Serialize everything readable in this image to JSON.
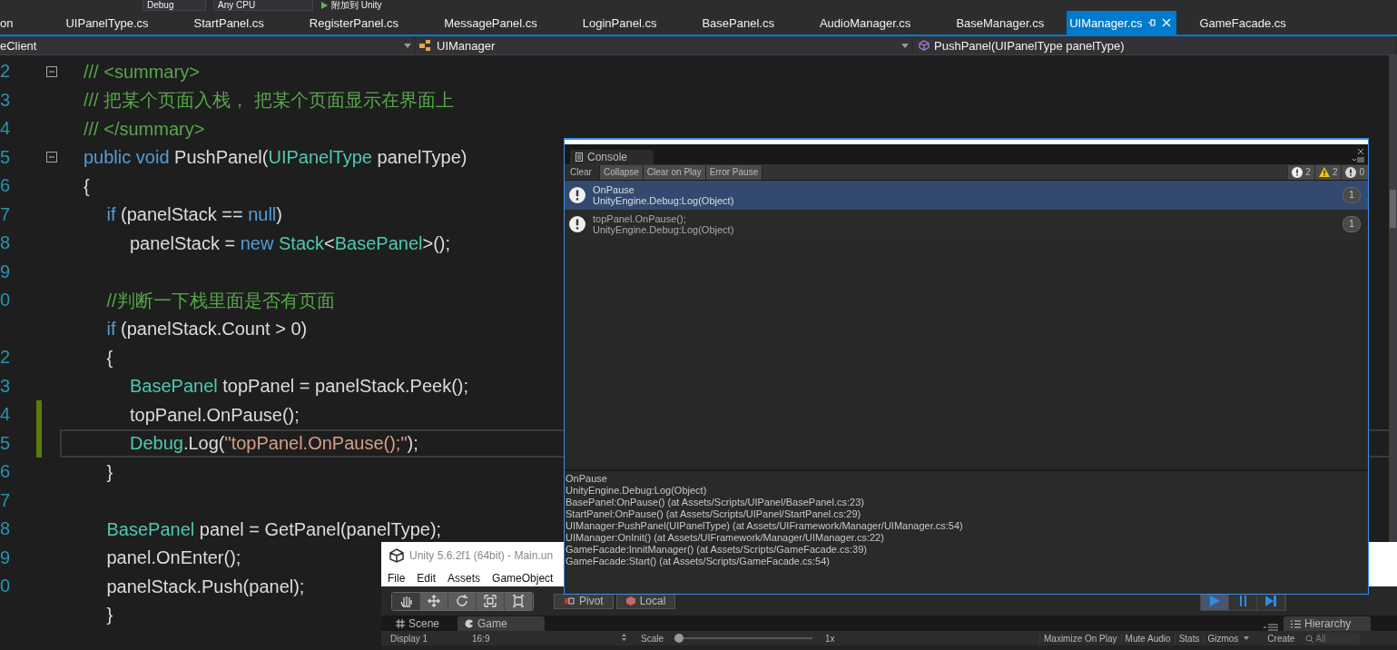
{
  "toolbar": {
    "configuration": "Debug",
    "platform": "Any CPU",
    "run_button": "附加到 Unity"
  },
  "tabs": [
    {
      "label": "on",
      "selected": false
    },
    {
      "label": "UIPanelType.cs",
      "selected": false
    },
    {
      "label": "StartPanel.cs",
      "selected": false
    },
    {
      "label": "RegisterPanel.cs",
      "selected": false
    },
    {
      "label": "MessagePanel.cs",
      "selected": false
    },
    {
      "label": "LoginPanel.cs",
      "selected": false
    },
    {
      "label": "BasePanel.cs",
      "selected": false
    },
    {
      "label": "AudioManager.cs",
      "selected": false
    },
    {
      "label": "BaseManager.cs",
      "selected": false
    },
    {
      "label": "UIManager.cs",
      "selected": true
    },
    {
      "label": "GameFacade.cs",
      "selected": false
    }
  ],
  "nav": {
    "project": "eClient",
    "class": "UIManager",
    "member": "PushPanel(UIPanelType panelType)"
  },
  "code": {
    "lines": [
      {
        "number": "2",
        "fold": true,
        "changed": false,
        "current": false,
        "tokens": [
          {
            "kind": "comment",
            "text": "/// <summary>"
          }
        ]
      },
      {
        "number": "3",
        "fold": false,
        "changed": false,
        "current": false,
        "tokens": [
          {
            "kind": "comment",
            "text": "/// 把某个页面入栈， 把某个页面显示在界面上"
          }
        ]
      },
      {
        "number": "4",
        "fold": false,
        "changed": false,
        "current": false,
        "tokens": [
          {
            "kind": "comment",
            "text": "/// </summary>"
          }
        ]
      },
      {
        "number": "5",
        "fold": true,
        "changed": false,
        "current": false,
        "tokens": [
          {
            "kind": "keyword",
            "text": "public void "
          },
          {
            "kind": "plain",
            "text": "PushPanel("
          },
          {
            "kind": "type",
            "text": "UIPanelType"
          },
          {
            "kind": "plain",
            "text": " panelType)"
          }
        ]
      },
      {
        "number": "6",
        "fold": false,
        "changed": false,
        "current": false,
        "tokens": [
          {
            "kind": "plain",
            "text": "{"
          }
        ]
      },
      {
        "number": "7",
        "fold": false,
        "changed": false,
        "current": false,
        "tokens": [
          {
            "kind": "keyword",
            "text": "\tif"
          },
          {
            "kind": "plain",
            "text": " (panelStack == "
          },
          {
            "kind": "keyword",
            "text": "null"
          },
          {
            "kind": "plain",
            "text": ")"
          }
        ]
      },
      {
        "number": "8",
        "fold": false,
        "changed": false,
        "current": false,
        "tokens": [
          {
            "kind": "plain",
            "text": "\t\tpanelStack = "
          },
          {
            "kind": "keyword",
            "text": "new "
          },
          {
            "kind": "type",
            "text": "Stack"
          },
          {
            "kind": "plain",
            "text": "<"
          },
          {
            "kind": "type",
            "text": "BasePanel"
          },
          {
            "kind": "plain",
            "text": ">();"
          }
        ]
      },
      {
        "number": "9",
        "fold": false,
        "changed": false,
        "current": false
      },
      {
        "number": "0",
        "fold": false,
        "changed": false,
        "current": false,
        "tokens": [
          {
            "kind": "comment",
            "text": "\t//判断一下栈里面是否有页面"
          }
        ]
      },
      {
        "fold": false,
        "changed": false,
        "current": false,
        "tokens": [
          {
            "kind": "keyword",
            "text": "\tif"
          },
          {
            "kind": "plain",
            "text": " (panelStack.Count > 0)"
          }
        ]
      },
      {
        "number": "2",
        "fold": false,
        "changed": false,
        "current": false,
        "tokens": [
          {
            "kind": "plain",
            "text": "\t{"
          }
        ]
      },
      {
        "number": "3",
        "fold": false,
        "changed": false,
        "current": false,
        "tokens": [
          {
            "kind": "type",
            "text": "\t\tBasePanel"
          },
          {
            "kind": "plain",
            "text": " topPanel = panelStack.Peek();"
          }
        ]
      },
      {
        "number": "4",
        "fold": false,
        "changed": true,
        "current": false,
        "tokens": [
          {
            "kind": "plain",
            "text": "\t\ttopPanel.OnPause();"
          }
        ]
      },
      {
        "number": "5",
        "fold": false,
        "changed": true,
        "current": true,
        "tokens": [
          {
            "kind": "type",
            "text": "\t\tDebug"
          },
          {
            "kind": "plain",
            "text": ".Log("
          },
          {
            "kind": "string",
            "text": "\"topPanel.OnPause();\""
          },
          {
            "kind": "plain",
            "text": ");"
          }
        ]
      },
      {
        "number": "6",
        "fold": false,
        "changed": false,
        "current": false,
        "tokens": [
          {
            "kind": "plain",
            "text": "\t}"
          }
        ]
      },
      {
        "number": "7",
        "fold": false,
        "changed": false,
        "current": false
      },
      {
        "number": "8",
        "fold": false,
        "changed": false,
        "current": false,
        "tokens": [
          {
            "kind": "type",
            "text": "\tBasePanel"
          },
          {
            "kind": "plain",
            "text": " panel = GetPanel(panelType);"
          }
        ]
      },
      {
        "number": "9",
        "fold": false,
        "changed": false,
        "current": false,
        "tokens": [
          {
            "kind": "plain",
            "text": "\tpanel.OnEnter();"
          }
        ]
      },
      {
        "number": "0",
        "fold": false,
        "changed": false,
        "current": false,
        "tokens": [
          {
            "kind": "plain",
            "text": "\tpanelStack.Push(panel);"
          }
        ]
      },
      {
        "fold": false,
        "changed": false,
        "current": false,
        "tokens": [
          {
            "kind": "plain",
            "text": "\t}"
          }
        ]
      }
    ]
  },
  "console": {
    "tab": "Console",
    "buttons": [
      {
        "label": "Clear",
        "on": false
      },
      {
        "label": "Collapse",
        "on": true
      },
      {
        "label": "Clear on Play",
        "on": true
      },
      {
        "label": "Error Pause",
        "on": true
      }
    ],
    "counts": [
      {
        "kind": "info",
        "count": "2"
      },
      {
        "kind": "warning",
        "count": "2"
      },
      {
        "kind": "error",
        "count": "0"
      }
    ],
    "entries": [
      {
        "message": "OnPause",
        "source": "UnityEngine.Debug:Log(Object)",
        "count": "1",
        "selected": true
      },
      {
        "message": "topPanel.OnPause();",
        "source": "UnityEngine.Debug:Log(Object)",
        "count": "1",
        "selected": false
      }
    ],
    "detail": [
      "OnPause",
      "UnityEngine.Debug:Log(Object)",
      "BasePanel:OnPause() (at Assets/Scripts/UIPanel/BasePanel.cs:23)",
      "StartPanel:OnPause() (at Assets/Scripts/UIPanel/StartPanel.cs:29)",
      "UIManager:PushPanel(UIPanelType) (at Assets/UIFramework/Manager/UIManager.cs:54)",
      "UIManager:OnInit() (at Assets/UIFramework/Manager/UIManager.cs:22)",
      "GameFacade:InnitManager() (at Assets/Scripts/GameFacade.cs:39)",
      "GameFacade:Start() (at Assets/Scripts/GameFacade.cs:54)"
    ]
  },
  "unity": {
    "title": "Unity 5.6.2f1 (64bit) - Main.un",
    "menu": [
      "File",
      "Edit",
      "Assets",
      "GameObject"
    ],
    "tools": [
      {
        "kind": "hand",
        "selected": true
      },
      {
        "kind": "move",
        "selected": false
      },
      {
        "kind": "rotate",
        "selected": false
      },
      {
        "kind": "scale",
        "selected": false
      },
      {
        "kind": "rect",
        "selected": false
      }
    ],
    "pivot": "Pivot",
    "local": "Local",
    "playback": [
      {
        "kind": "play",
        "selected": true
      },
      {
        "kind": "pause",
        "selected": false
      },
      {
        "kind": "step",
        "selected": false
      }
    ],
    "views": [
      {
        "kind": "scene",
        "label": "Scene",
        "selected": false
      },
      {
        "kind": "game",
        "label": "Game",
        "selected": true
      }
    ],
    "display": "Display 1",
    "aspect": "16:9",
    "scale_label": "Scale",
    "scale": {
      "level": 0
    },
    "scale_value": "1x",
    "game_options": [
      "Maximize On Play",
      "Mute Audio",
      "Stats",
      "Gizmos"
    ],
    "hierarchy": {
      "tab": "Hierarchy",
      "create": "Create",
      "placeholder": "All"
    }
  }
}
